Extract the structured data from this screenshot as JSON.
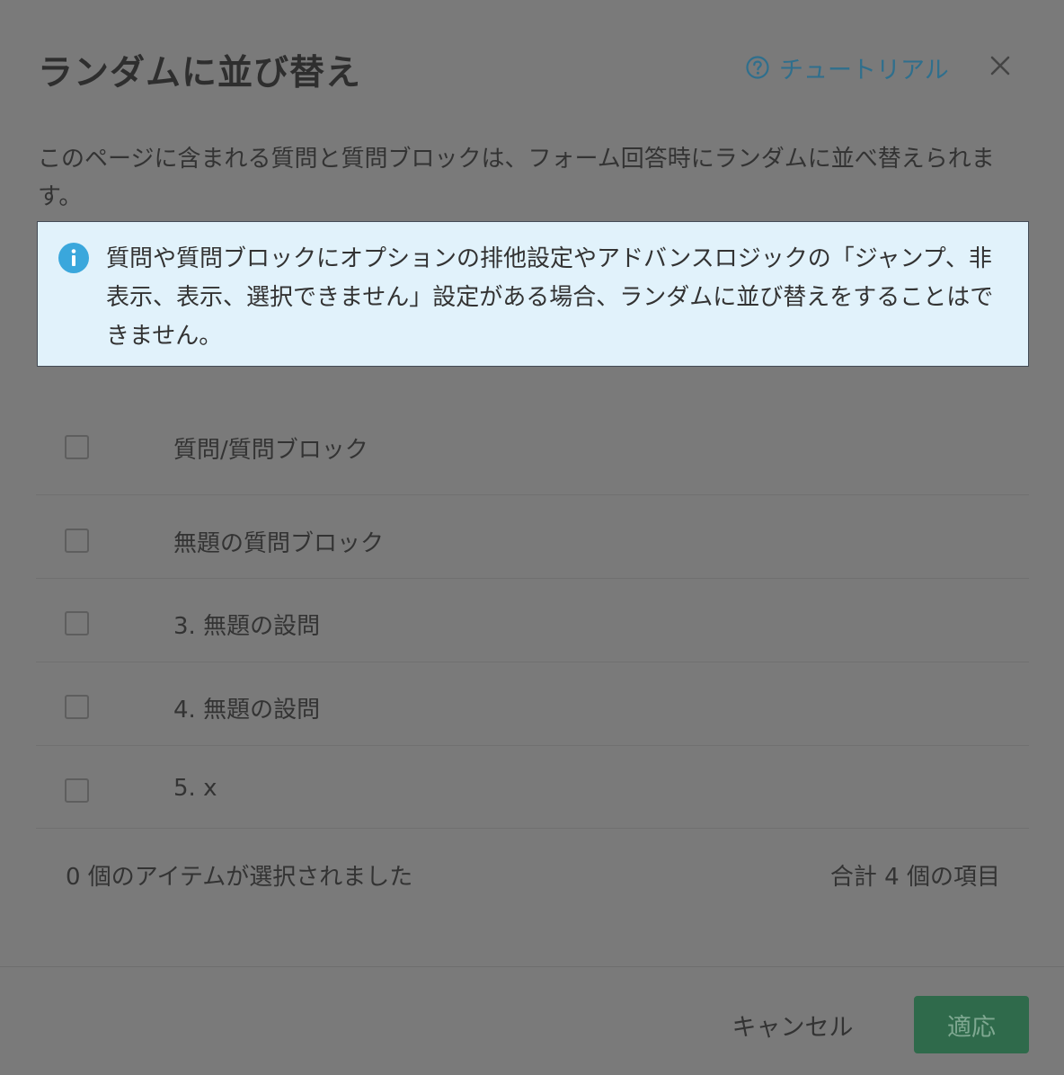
{
  "dialog": {
    "title": "ランダムに並び替え",
    "tutorial_label": "チュートリアル",
    "description": "このページに含まれる質問と質問ブロックは、フォーム回答時にランダムに並べ替えられます。",
    "info": {
      "text": "質問や質問ブロックにオプションの排他設定やアドバンスロジックの「ジャンプ、非表示、表示、選択できません」設定がある場合、ランダムに並び替えをすることはできません。",
      "icon": "info-icon",
      "background_color": "#e1f2fb",
      "icon_color": "#3aa7dc"
    },
    "list": {
      "header_label": "質問/質問ブロック",
      "items": [
        {
          "label": "無題の質問ブロック",
          "checked": false
        },
        {
          "label": "3. 無題の設問",
          "checked": false
        },
        {
          "label": "4. 無題の設問",
          "checked": false
        },
        {
          "label": "5. x",
          "checked": false
        }
      ]
    },
    "selected_count_text": "0 個のアイテムが選択されました",
    "total_text": "合計 4 個の項目",
    "buttons": {
      "cancel": "キャンセル",
      "apply": "適応"
    },
    "colors": {
      "accent": "#2f6a4b",
      "link": "#2f6f8d"
    }
  }
}
